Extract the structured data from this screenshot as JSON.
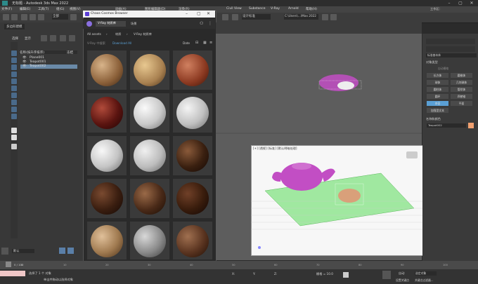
{
  "window": {
    "title": "无标题 - Autodesk 3ds Max 2022",
    "controls": [
      "–",
      "▢",
      "✕"
    ]
  },
  "menubar": [
    "文件(F)",
    "编辑(E)",
    "工具(T)",
    "组(G)",
    "视图(V)",
    "创建(C)",
    "修改器(M)",
    "动画(A)",
    "图形编辑器(D)",
    "渲染(R)",
    "Civil View",
    "Substance",
    "V-Ray",
    "Arnold",
    "帮助(H)"
  ],
  "toolbar": {
    "left_dropdown": "全部",
    "right_label": "工作区：",
    "workspace": "设计标准",
    "path": "C:\\Users\\...\\Max 2022"
  },
  "left": {
    "tabs": [
      "选择",
      "显示"
    ],
    "filter": "名称(按升序排序)",
    "toolbar_label": "多边形建模",
    "freeze_col": "冻结",
    "items": [
      "Plane001",
      "Teapot001",
      "Teapot002"
    ],
    "layer": "默认"
  },
  "chaos": {
    "title": "Chaos Cosmos Browser",
    "tab_active": "V-Ray 材质库",
    "tab2": "场景",
    "filter_all": "All assets",
    "filter_mat": "材质",
    "filter_vray": "V-Ray 材质库",
    "search_placeholder": "V-Ray 中搜索",
    "download_all": "Download All",
    "sort": "Date"
  },
  "viewports": {
    "persp_label": "[+] [透视] [标准] [默认明暗处理]"
  },
  "cmd": {
    "section1": "对象类型",
    "autogrid": "自动栅格",
    "buttons": [
      "长方体",
      "圆锥体",
      "球体",
      "几何球体",
      "圆柱体",
      "管状体",
      "圆环",
      "四棱锥",
      "茶壶",
      "平面",
      "加强型文本"
    ],
    "section2": "名称和颜色",
    "name": "Teapot002",
    "category": "标准基本体"
  },
  "status": {
    "select_info": "选择了 1 个 对象",
    "hint": "单击并拖动以选择对象",
    "x_label": "X:",
    "y_label": "Y:",
    "z_label": "Z:",
    "grid": "栅格 = 10.0",
    "frame": "0 / 100",
    "autokey": "自动",
    "selected": "选定对象",
    "setkey": "设置关键点",
    "keyfilter": "关键点过滤器..."
  },
  "timeline_ticks": [
    "0",
    "10",
    "20",
    "30",
    "40",
    "50",
    "60",
    "70",
    "80",
    "90",
    "100"
  ],
  "colors": {
    "accent": "#5a9fd4",
    "teapot_pink": "#c24ec4",
    "teapot_tan": "#d9a07a",
    "plane_green": "#8fe08f",
    "name_swatch": "#f0a070"
  }
}
